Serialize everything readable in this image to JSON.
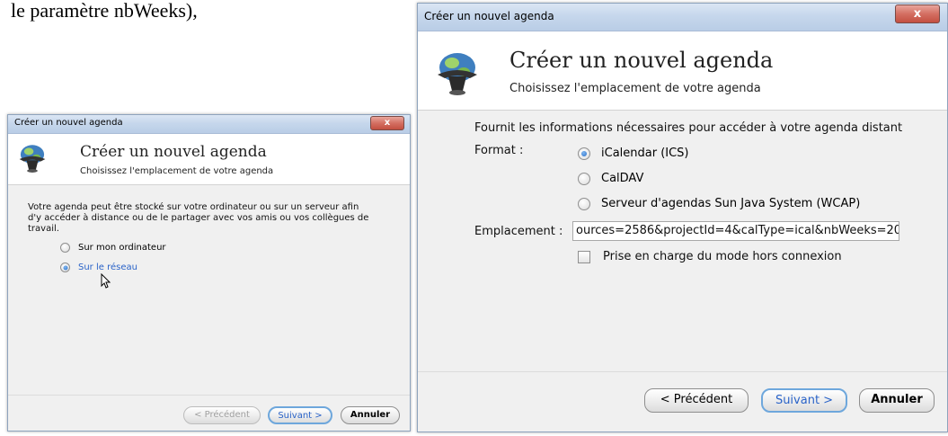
{
  "doc_fragment": "le paramètre nbWeeks),",
  "window1": {
    "title": "Créer un nouvel agenda",
    "close_label": "x",
    "header_title": "Créer un nouvel agenda",
    "header_subtitle": "Choisissez l'emplacement de votre agenda",
    "description": "Votre agenda peut être stocké sur votre ordinateur ou sur un serveur afin d'y accéder à distance ou de le partager avec vos amis ou vos collègues de travail.",
    "options": [
      {
        "label": "Sur mon ordinateur",
        "checked": false
      },
      {
        "label": "Sur le réseau",
        "checked": true
      }
    ],
    "buttons": {
      "previous": "< Précédent",
      "next": "Suivant >",
      "cancel": "Annuler"
    }
  },
  "window2": {
    "title": "Créer un nouvel agenda",
    "close_label": "x",
    "header_title": "Créer un nouvel agenda",
    "header_subtitle": "Choisissez l'emplacement de votre agenda",
    "info": "Fournit les informations nécessaires pour accéder à votre agenda distant",
    "format_label": "Format :",
    "formats": [
      {
        "label": "iCalendar (ICS)",
        "checked": true
      },
      {
        "label": "CalDAV",
        "checked": false
      },
      {
        "label": "Serveur d'agendas Sun Java System (WCAP)",
        "checked": false
      }
    ],
    "location_label": "Emplacement :",
    "location_value": "ources=2586&projectId=4&calType=ical&nbWeeks=20",
    "offline_label": "Prise en charge du mode hors connexion",
    "buttons": {
      "previous": "< Précédent",
      "next": "Suivant >",
      "cancel": "Annuler"
    }
  }
}
